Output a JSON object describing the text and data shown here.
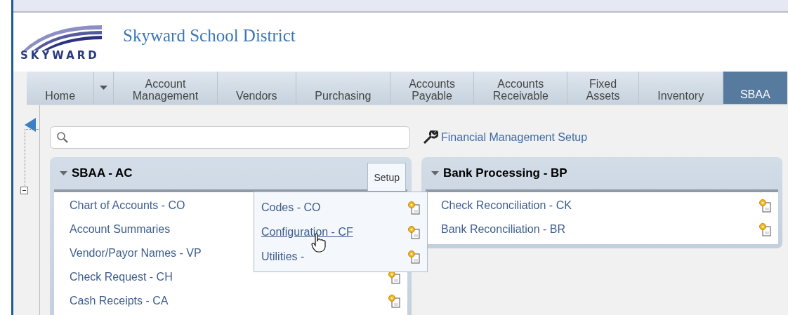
{
  "header": {
    "logo_text": "SKYWARD",
    "title": "Skyward School District"
  },
  "nav": {
    "tabs": [
      {
        "label": "Home",
        "selected": false,
        "dropdown": true
      },
      {
        "label": "Account Management",
        "selected": false,
        "dropdown": false
      },
      {
        "label": "Vendors",
        "selected": false,
        "dropdown": false
      },
      {
        "label": "Purchasing",
        "selected": false,
        "dropdown": false
      },
      {
        "label": "Accounts Payable",
        "selected": false,
        "dropdown": false
      },
      {
        "label": "Accounts Receivable",
        "selected": false,
        "dropdown": false
      },
      {
        "label": "Fixed Assets",
        "selected": false,
        "dropdown": false
      },
      {
        "label": "Inventory",
        "selected": false,
        "dropdown": false
      },
      {
        "label": "SBAA",
        "selected": true,
        "dropdown": false
      }
    ]
  },
  "setup_link": "Financial Management Setup",
  "panels": [
    {
      "title": "SBAA - AC",
      "setup_tab": "Setup",
      "items": [
        {
          "label": "Chart of Accounts - CO",
          "icon": false
        },
        {
          "label": "Account Summaries",
          "icon": false
        },
        {
          "label": "Vendor/Payor Names - VP",
          "icon": false
        },
        {
          "label": "Check Request - CH",
          "icon": true
        },
        {
          "label": "Cash Receipts - CA",
          "icon": true
        }
      ],
      "setup_menu": [
        {
          "label": "Codes - CO",
          "hovered": false
        },
        {
          "label": "Configuration - CF",
          "hovered": true
        },
        {
          "label": "Utilities -",
          "hovered": false
        }
      ]
    },
    {
      "title": "Bank Processing - BP",
      "items": [
        {
          "label": "Check Reconciliation - CK",
          "icon": true
        },
        {
          "label": "Bank Reconciliation - BR",
          "icon": true
        }
      ]
    }
  ]
}
